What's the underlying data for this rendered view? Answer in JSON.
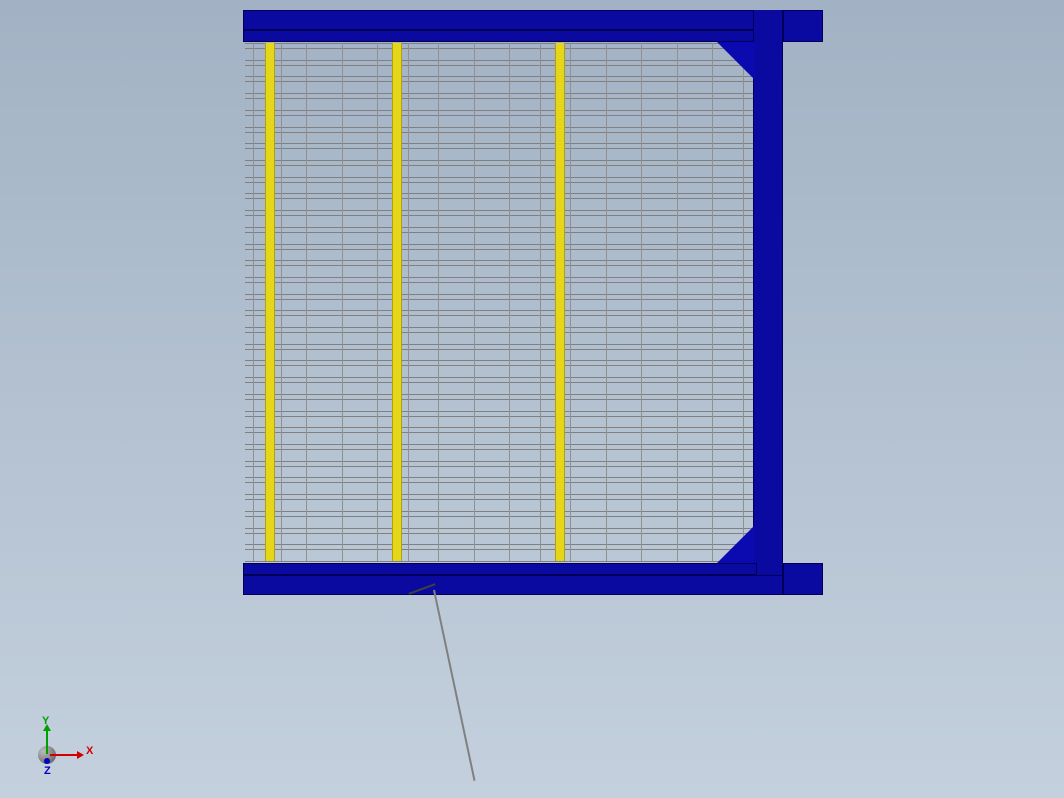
{
  "triad": {
    "x_label": "X",
    "y_label": "Y",
    "z_label": "Z"
  },
  "model": {
    "frame_color": "#0a0aa0",
    "accent_bar_color": "#e6d61a",
    "yellow_bar_positions_pct": [
      4,
      29,
      61
    ],
    "vertical_gridline_positions_pct": [
      1.5,
      7,
      12,
      19,
      26,
      32,
      38,
      45,
      52,
      58,
      64,
      71,
      78,
      85,
      92,
      98
    ],
    "horizontal_slat_count": 32
  }
}
